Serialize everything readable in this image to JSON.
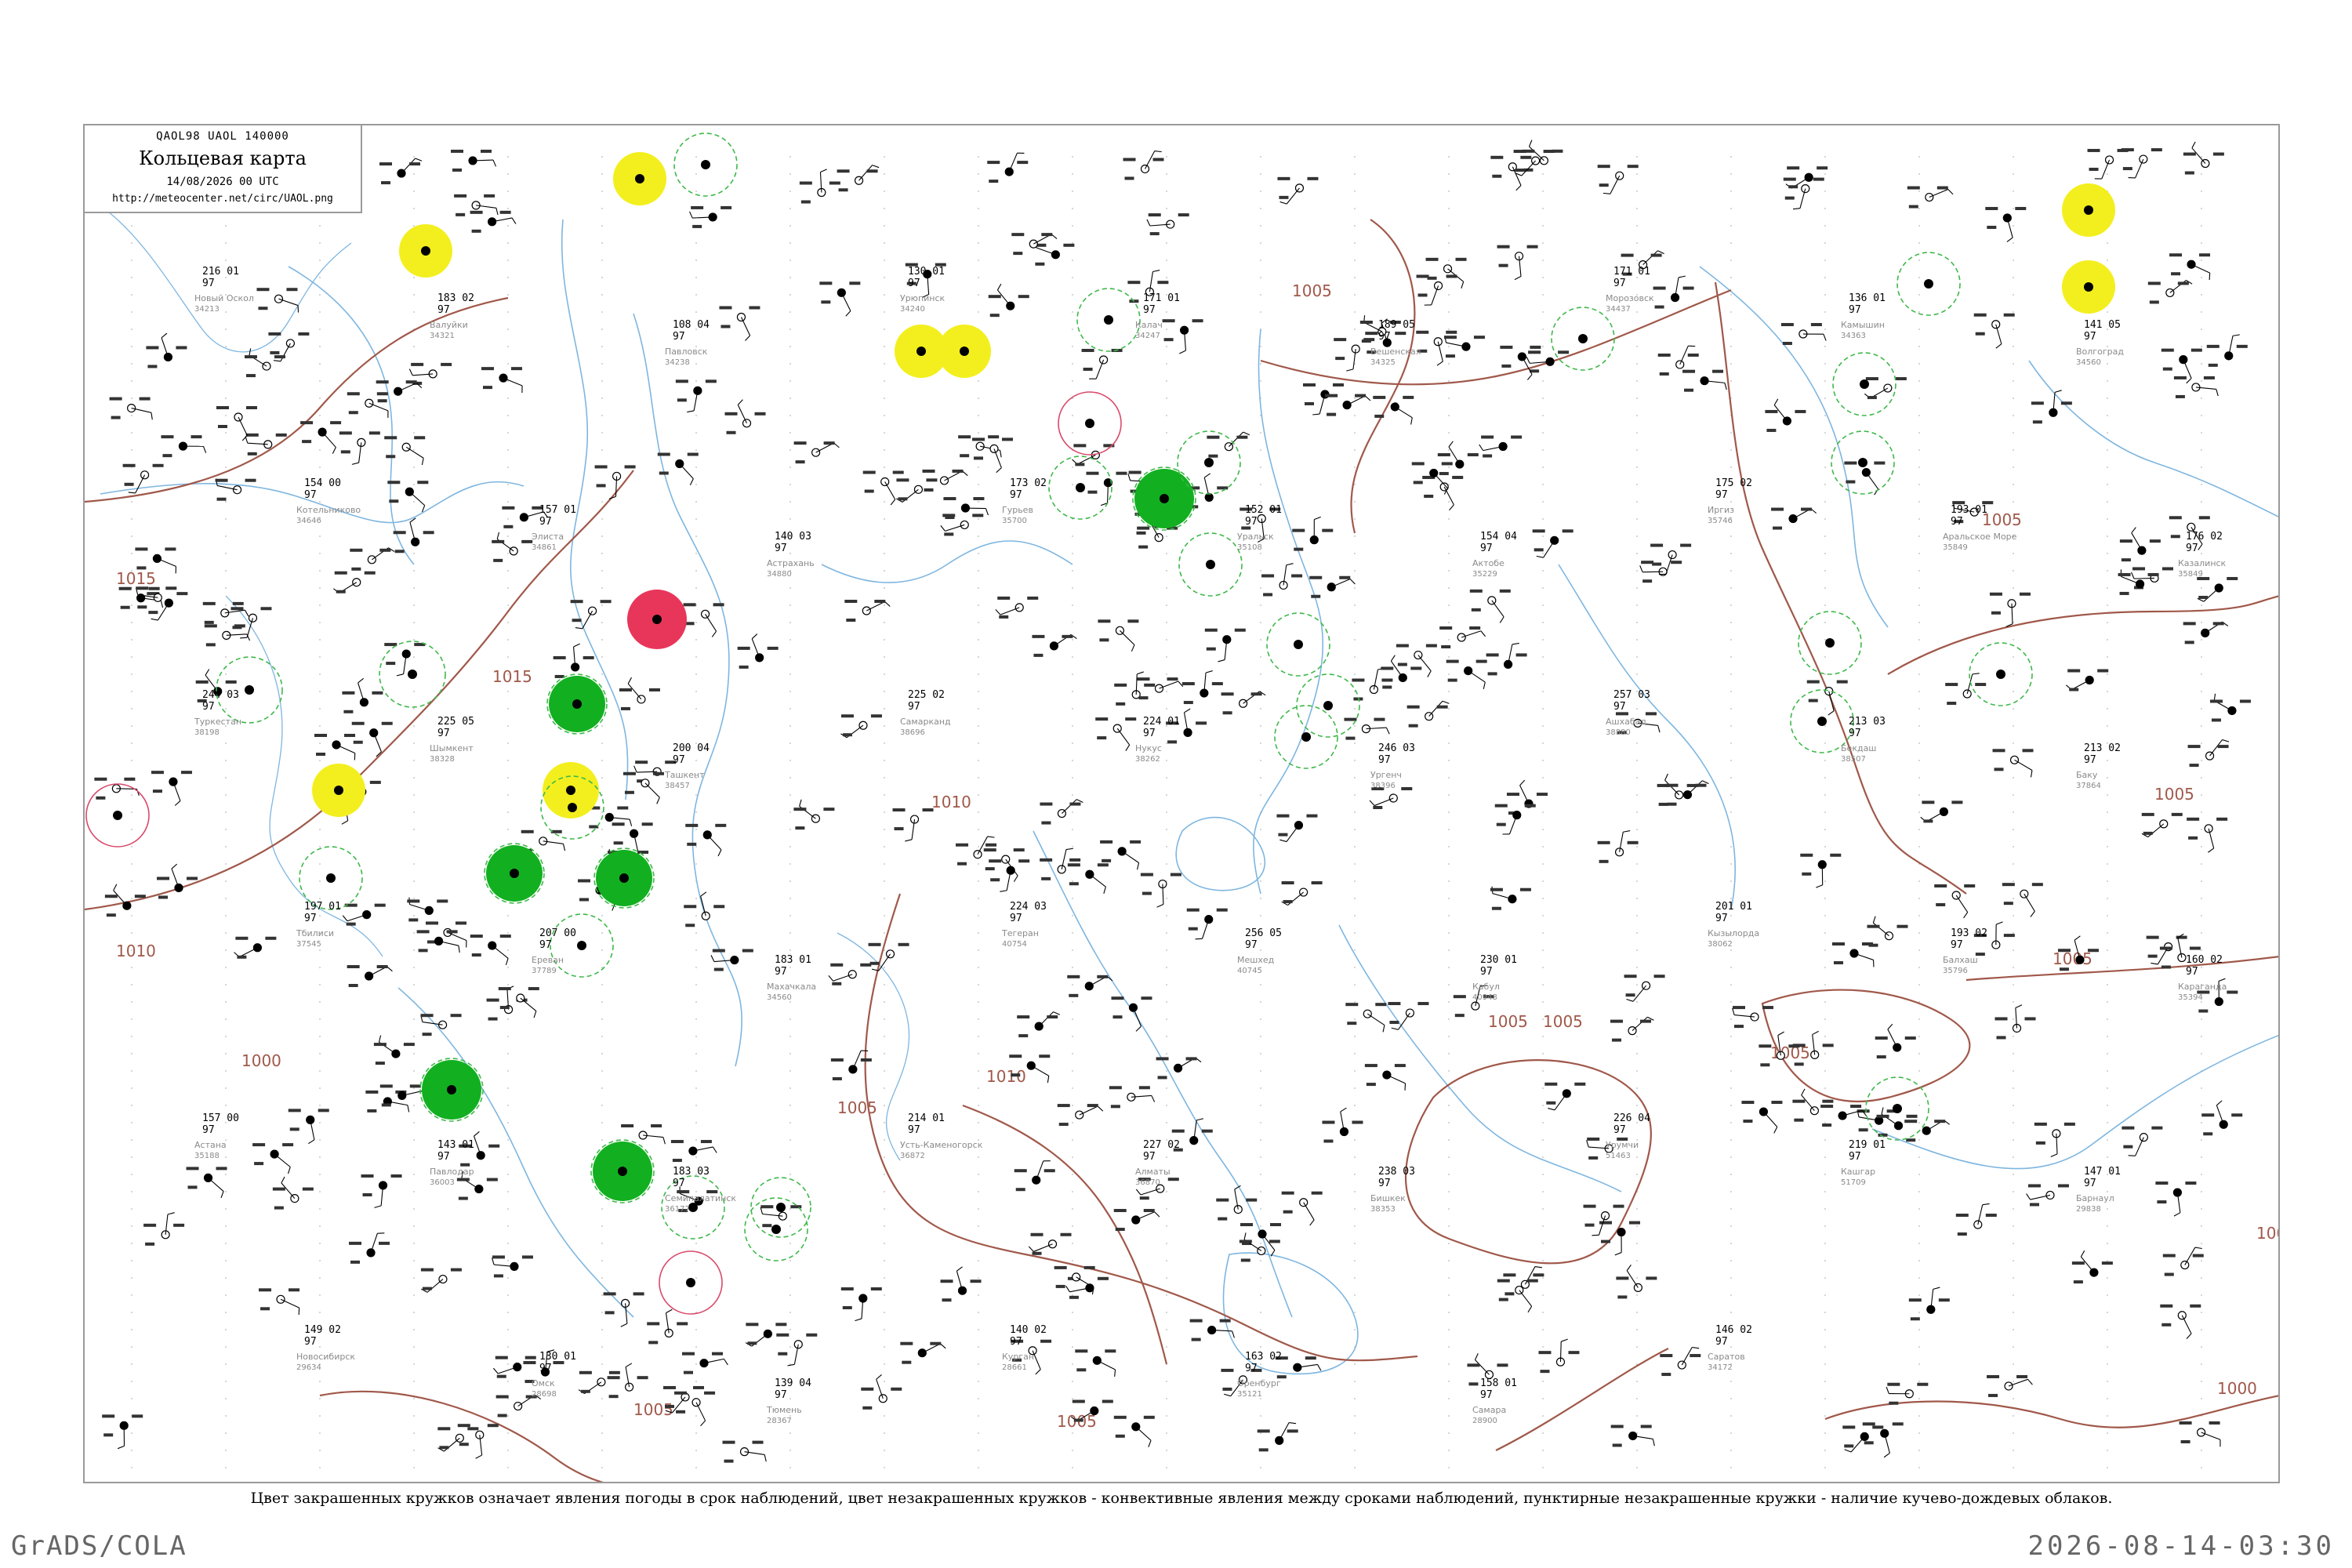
{
  "header": {
    "code_line": "QAOL98  UAOL  140000",
    "title": "Кольцевая карта",
    "datetime": "14/08/2026 00 UTC",
    "url": "http://meteocenter.net/circ/UAOL.png"
  },
  "caption": "Цвет закрашенных кружков означает явления погоды в срок наблюдений, цвет незакрашенных кружков - конвективные явления между сроками наблюдений, пунктирные незакрашенные кружки - наличие кучево-дождевых облаков.",
  "footer": {
    "software": "GrADS/COLA",
    "timestamp": "2026-08-14-03:30"
  },
  "colors": {
    "isobar": "#a0584a",
    "river": "#7eb6e0",
    "green_fill": "#12b020",
    "yellow_fill": "#f3ef1e",
    "red_fill": "#e8365a",
    "green_ring": "#3fb84a",
    "red_ring": "#d84a6a"
  },
  "isobars": [
    "1015",
    "1015",
    "1010",
    "1005",
    "1005",
    "1000",
    "1005",
    "1010",
    "1010",
    "1005",
    "1005",
    "1005",
    "1005",
    "1000",
    "1005",
    "1005",
    "1005",
    "1000"
  ],
  "stations": [
    {
      "name": "Новый Оскол",
      "id": "34213",
      "a": "216",
      "b": "97",
      "c": "01"
    },
    {
      "name": "Валуйки",
      "id": "34321",
      "a": "183",
      "b": "97",
      "c": "02"
    },
    {
      "name": "Павловск",
      "id": "34238",
      "a": "108",
      "b": "97",
      "c": "04"
    },
    {
      "name": "Урюпинск",
      "id": "34240",
      "a": "130",
      "b": "97",
      "c": "01"
    },
    {
      "name": "Калач",
      "id": "34247",
      "a": "171",
      "b": "97",
      "c": "01"
    },
    {
      "name": "Вешенская",
      "id": "34325",
      "a": "189",
      "b": "97",
      "c": "05"
    },
    {
      "name": "Морозовск",
      "id": "34437",
      "a": "171",
      "b": "97",
      "c": "01"
    },
    {
      "name": "Камышин",
      "id": "34363",
      "a": "136",
      "b": "97",
      "c": "01"
    },
    {
      "name": "Волгоград",
      "id": "34560",
      "a": "141",
      "b": "97",
      "c": "05"
    },
    {
      "name": "Котельниково",
      "id": "34646",
      "a": "154",
      "b": "97",
      "c": "00"
    },
    {
      "name": "Элиста",
      "id": "34861",
      "a": "157",
      "b": "97",
      "c": "01"
    },
    {
      "name": "Астрахань",
      "id": "34880",
      "a": "140",
      "b": "97",
      "c": "03"
    },
    {
      "name": "Гурьев",
      "id": "35700",
      "a": "173",
      "b": "97",
      "c": "02"
    },
    {
      "name": "Уральск",
      "id": "35108",
      "a": "152",
      "b": "97",
      "c": "01"
    },
    {
      "name": "Актобе",
      "id": "35229",
      "a": "154",
      "b": "97",
      "c": "04"
    },
    {
      "name": "Иргиз",
      "id": "35746",
      "a": "175",
      "b": "97",
      "c": "02"
    },
    {
      "name": "Аральское Море",
      "id": "35849",
      "a": "193",
      "b": "97",
      "c": "01"
    },
    {
      "name": "Казалинск",
      "id": "35849",
      "a": "176",
      "b": "97",
      "c": "02"
    },
    {
      "name": "Туркестан",
      "id": "38198",
      "a": "244",
      "b": "97",
      "c": "03"
    },
    {
      "name": "Шымкент",
      "id": "38328",
      "a": "225",
      "b": "97",
      "c": "05"
    },
    {
      "name": "Ташкент",
      "id": "38457",
      "a": "200",
      "b": "97",
      "c": "04"
    },
    {
      "name": "Самарканд",
      "id": "38696",
      "a": "225",
      "b": "97",
      "c": "02"
    },
    {
      "name": "Нукус",
      "id": "38262",
      "a": "224",
      "b": "97",
      "c": "01"
    },
    {
      "name": "Ургенч",
      "id": "38396",
      "a": "246",
      "b": "97",
      "c": "03"
    },
    {
      "name": "Ашхабад",
      "id": "38880",
      "a": "257",
      "b": "97",
      "c": "03"
    },
    {
      "name": "Бекдаш",
      "id": "38507",
      "a": "213",
      "b": "97",
      "c": "03"
    },
    {
      "name": "Баку",
      "id": "37864",
      "a": "213",
      "b": "97",
      "c": "02"
    },
    {
      "name": "Тбилиси",
      "id": "37545",
      "a": "197",
      "b": "97",
      "c": "01"
    },
    {
      "name": "Ереван",
      "id": "37789",
      "a": "207",
      "b": "97",
      "c": "00"
    },
    {
      "name": "Махачкала",
      "id": "34560",
      "a": "183",
      "b": "97",
      "c": "01"
    },
    {
      "name": "Тегеран",
      "id": "40754",
      "a": "224",
      "b": "97",
      "c": "03"
    },
    {
      "name": "Мешхед",
      "id": "40745",
      "a": "256",
      "b": "97",
      "c": "05"
    },
    {
      "name": "Кабул",
      "id": "40948",
      "a": "230",
      "b": "97",
      "c": "01"
    },
    {
      "name": "Кызылорда",
      "id": "38062",
      "a": "201",
      "b": "97",
      "c": "01"
    },
    {
      "name": "Балхаш",
      "id": "35796",
      "a": "193",
      "b": "97",
      "c": "02"
    },
    {
      "name": "Караганда",
      "id": "35394",
      "a": "160",
      "b": "97",
      "c": "02"
    },
    {
      "name": "Астана",
      "id": "35188",
      "a": "157",
      "b": "97",
      "c": "00"
    },
    {
      "name": "Павлодар",
      "id": "36003",
      "a": "143",
      "b": "97",
      "c": "01"
    },
    {
      "name": "Семипалатинск",
      "id": "36177",
      "a": "183",
      "b": "97",
      "c": "03"
    },
    {
      "name": "Усть-Каменогорск",
      "id": "36872",
      "a": "214",
      "b": "97",
      "c": "01"
    },
    {
      "name": "Алматы",
      "id": "36870",
      "a": "227",
      "b": "97",
      "c": "02"
    },
    {
      "name": "Бишкек",
      "id": "38353",
      "a": "238",
      "b": "97",
      "c": "03"
    },
    {
      "name": "Урумчи",
      "id": "51463",
      "a": "226",
      "b": "97",
      "c": "04"
    },
    {
      "name": "Кашгар",
      "id": "51709",
      "a": "219",
      "b": "97",
      "c": "01"
    },
    {
      "name": "Барнаул",
      "id": "29838",
      "a": "147",
      "b": "97",
      "c": "01"
    },
    {
      "name": "Новосибирск",
      "id": "29634",
      "a": "149",
      "b": "97",
      "c": "02"
    },
    {
      "name": "Омск",
      "id": "28698",
      "a": "130",
      "b": "97",
      "c": "01"
    },
    {
      "name": "Тюмень",
      "id": "28367",
      "a": "139",
      "b": "97",
      "c": "04"
    },
    {
      "name": "Курган",
      "id": "28661",
      "a": "140",
      "b": "97",
      "c": "02"
    },
    {
      "name": "Оренбург",
      "id": "35121",
      "a": "163",
      "b": "97",
      "c": "02"
    },
    {
      "name": "Самара",
      "id": "28900",
      "a": "158",
      "b": "97",
      "c": "01"
    },
    {
      "name": "Саратов",
      "id": "34172",
      "a": "146",
      "b": "97",
      "c": "02"
    }
  ]
}
